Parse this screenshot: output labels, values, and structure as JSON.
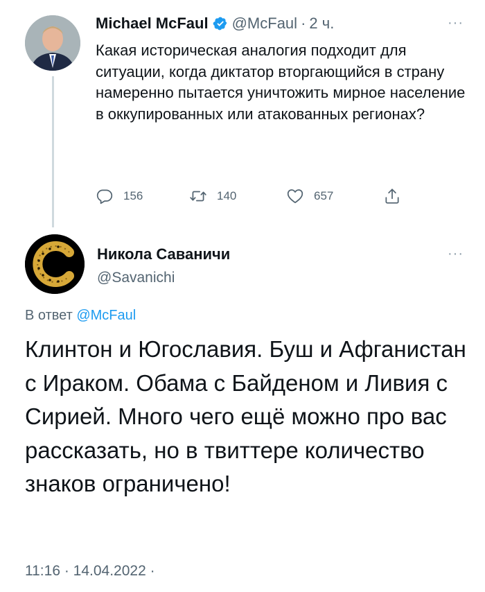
{
  "parent_tweet": {
    "author_name": "Michael McFaul",
    "handle": "@McFaul",
    "separator": "·",
    "time": "2 ч.",
    "more": "···",
    "text": "Какая историческая аналогия подходит для ситуации, когда диктатор вторгающийся в страну намеренно пытается уничтожить мирное население в оккупированных или атакованных регионах?",
    "replies": "156",
    "retweets": "140",
    "likes": "657",
    "verified_color": "#1d9bf0",
    "icons": {
      "reply": "reply-icon",
      "retweet": "retweet-icon",
      "like": "heart-icon",
      "share": "share-icon"
    }
  },
  "reply_tweet": {
    "author_name": "Никола Саваничи",
    "handle": "@Savanichi",
    "more": "···",
    "reply_prefix": "В ответ",
    "reply_to_handle": "@McFaul",
    "text": "Клинтон и Югославия. Буш и Афганистан с Ираком. Обама с Байденом и Ливия с Сирией. Много чего ещё можно про вас рассказать, но в твиттере количество знаков ограничено!",
    "timestamp": "11:16 · 14.04.2022 ·",
    "link_color": "#1d9bf0"
  }
}
